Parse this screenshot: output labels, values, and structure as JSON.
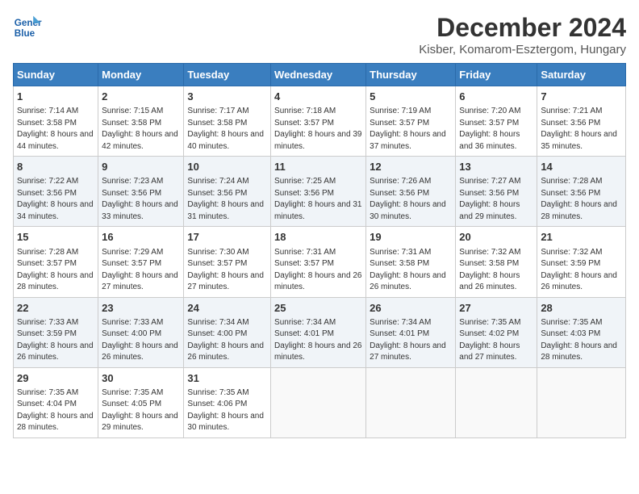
{
  "logo": {
    "line1": "General",
    "line2": "Blue"
  },
  "title": "December 2024",
  "subtitle": "Kisber, Komarom-Esztergom, Hungary",
  "days_header": [
    "Sunday",
    "Monday",
    "Tuesday",
    "Wednesday",
    "Thursday",
    "Friday",
    "Saturday"
  ],
  "weeks": [
    [
      {
        "day": "1",
        "sunrise": "7:14 AM",
        "sunset": "3:58 PM",
        "daylight": "8 hours and 44 minutes."
      },
      {
        "day": "2",
        "sunrise": "7:15 AM",
        "sunset": "3:58 PM",
        "daylight": "8 hours and 42 minutes."
      },
      {
        "day": "3",
        "sunrise": "7:17 AM",
        "sunset": "3:58 PM",
        "daylight": "8 hours and 40 minutes."
      },
      {
        "day": "4",
        "sunrise": "7:18 AM",
        "sunset": "3:57 PM",
        "daylight": "8 hours and 39 minutes."
      },
      {
        "day": "5",
        "sunrise": "7:19 AM",
        "sunset": "3:57 PM",
        "daylight": "8 hours and 37 minutes."
      },
      {
        "day": "6",
        "sunrise": "7:20 AM",
        "sunset": "3:57 PM",
        "daylight": "8 hours and 36 minutes."
      },
      {
        "day": "7",
        "sunrise": "7:21 AM",
        "sunset": "3:56 PM",
        "daylight": "8 hours and 35 minutes."
      }
    ],
    [
      {
        "day": "8",
        "sunrise": "7:22 AM",
        "sunset": "3:56 PM",
        "daylight": "8 hours and 34 minutes."
      },
      {
        "day": "9",
        "sunrise": "7:23 AM",
        "sunset": "3:56 PM",
        "daylight": "8 hours and 33 minutes."
      },
      {
        "day": "10",
        "sunrise": "7:24 AM",
        "sunset": "3:56 PM",
        "daylight": "8 hours and 31 minutes."
      },
      {
        "day": "11",
        "sunrise": "7:25 AM",
        "sunset": "3:56 PM",
        "daylight": "8 hours and 31 minutes."
      },
      {
        "day": "12",
        "sunrise": "7:26 AM",
        "sunset": "3:56 PM",
        "daylight": "8 hours and 30 minutes."
      },
      {
        "day": "13",
        "sunrise": "7:27 AM",
        "sunset": "3:56 PM",
        "daylight": "8 hours and 29 minutes."
      },
      {
        "day": "14",
        "sunrise": "7:28 AM",
        "sunset": "3:56 PM",
        "daylight": "8 hours and 28 minutes."
      }
    ],
    [
      {
        "day": "15",
        "sunrise": "7:28 AM",
        "sunset": "3:57 PM",
        "daylight": "8 hours and 28 minutes."
      },
      {
        "day": "16",
        "sunrise": "7:29 AM",
        "sunset": "3:57 PM",
        "daylight": "8 hours and 27 minutes."
      },
      {
        "day": "17",
        "sunrise": "7:30 AM",
        "sunset": "3:57 PM",
        "daylight": "8 hours and 27 minutes."
      },
      {
        "day": "18",
        "sunrise": "7:31 AM",
        "sunset": "3:57 PM",
        "daylight": "8 hours and 26 minutes."
      },
      {
        "day": "19",
        "sunrise": "7:31 AM",
        "sunset": "3:58 PM",
        "daylight": "8 hours and 26 minutes."
      },
      {
        "day": "20",
        "sunrise": "7:32 AM",
        "sunset": "3:58 PM",
        "daylight": "8 hours and 26 minutes."
      },
      {
        "day": "21",
        "sunrise": "7:32 AM",
        "sunset": "3:59 PM",
        "daylight": "8 hours and 26 minutes."
      }
    ],
    [
      {
        "day": "22",
        "sunrise": "7:33 AM",
        "sunset": "3:59 PM",
        "daylight": "8 hours and 26 minutes."
      },
      {
        "day": "23",
        "sunrise": "7:33 AM",
        "sunset": "4:00 PM",
        "daylight": "8 hours and 26 minutes."
      },
      {
        "day": "24",
        "sunrise": "7:34 AM",
        "sunset": "4:00 PM",
        "daylight": "8 hours and 26 minutes."
      },
      {
        "day": "25",
        "sunrise": "7:34 AM",
        "sunset": "4:01 PM",
        "daylight": "8 hours and 26 minutes."
      },
      {
        "day": "26",
        "sunrise": "7:34 AM",
        "sunset": "4:01 PM",
        "daylight": "8 hours and 27 minutes."
      },
      {
        "day": "27",
        "sunrise": "7:35 AM",
        "sunset": "4:02 PM",
        "daylight": "8 hours and 27 minutes."
      },
      {
        "day": "28",
        "sunrise": "7:35 AM",
        "sunset": "4:03 PM",
        "daylight": "8 hours and 28 minutes."
      }
    ],
    [
      {
        "day": "29",
        "sunrise": "7:35 AM",
        "sunset": "4:04 PM",
        "daylight": "8 hours and 28 minutes."
      },
      {
        "day": "30",
        "sunrise": "7:35 AM",
        "sunset": "4:05 PM",
        "daylight": "8 hours and 29 minutes."
      },
      {
        "day": "31",
        "sunrise": "7:35 AM",
        "sunset": "4:06 PM",
        "daylight": "8 hours and 30 minutes."
      },
      null,
      null,
      null,
      null
    ]
  ],
  "labels": {
    "sunrise": "Sunrise:",
    "sunset": "Sunset:",
    "daylight": "Daylight:"
  }
}
